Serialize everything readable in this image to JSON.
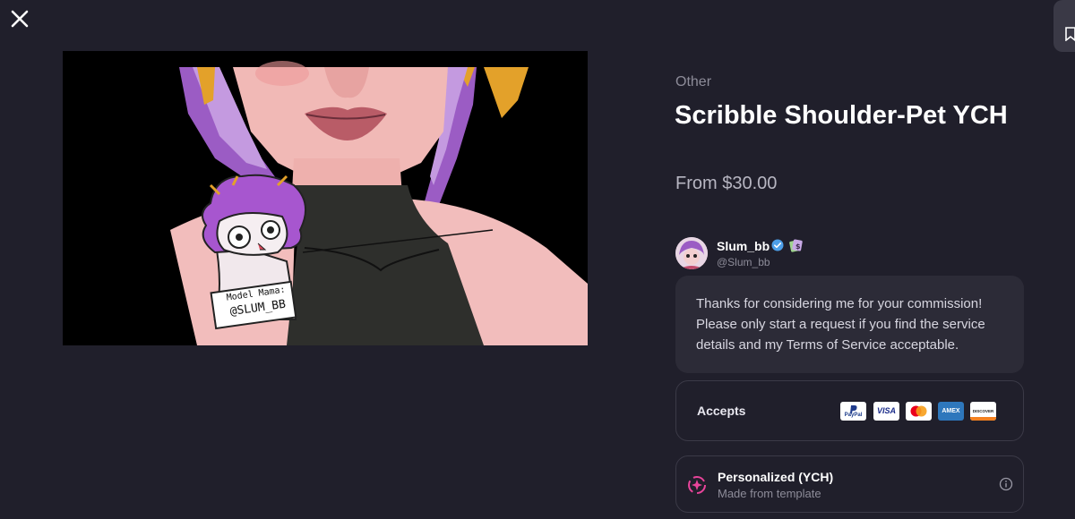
{
  "header": {
    "close_icon": "close-icon",
    "side_tab_icon": "bookmark-icon"
  },
  "listing": {
    "category": "Other",
    "title": "Scribble Shoulder-Pet YCH",
    "price": "From $30.00",
    "artwork_sign_line1": "Model Mama:",
    "artwork_sign_line2": "@SLUM_BB"
  },
  "seller": {
    "name": "Slum_bb",
    "handle": "@Slum_bb",
    "verified_icon": "verified-check-icon",
    "badge_icon": "money-badge-icon"
  },
  "message": "Thanks for considering me for your commission! Please only start a request if you find the service details and my Terms of Service acceptable.",
  "payments": {
    "label": "Accepts",
    "methods": [
      {
        "name": "PayPal",
        "text": "PayPal"
      },
      {
        "name": "Visa",
        "text": "VISA"
      },
      {
        "name": "Mastercard",
        "text": ""
      },
      {
        "name": "Amex",
        "text": "AMEX"
      },
      {
        "name": "Discover",
        "text": "DISCOVER"
      }
    ]
  },
  "commission_type": {
    "name": "Personalized (YCH)",
    "subtitle": "Made from template",
    "icon": "sparkle-swirl-icon",
    "info_icon": "info-icon"
  },
  "colors": {
    "background": "#201f2b",
    "panel": "#2c2b37",
    "border": "#3b3a47",
    "muted_text": "#8d8c99",
    "accent_pink": "#e9449b"
  }
}
